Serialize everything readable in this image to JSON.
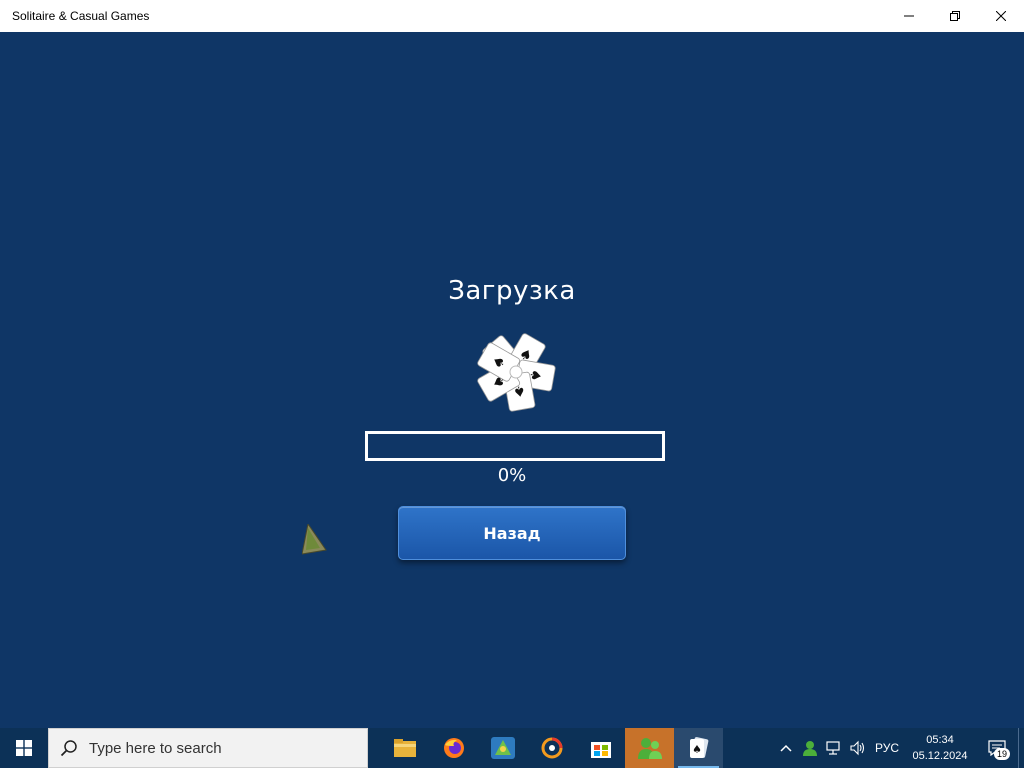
{
  "window": {
    "title": "Solitaire & Casual Games",
    "controls": [
      "minimize-icon",
      "restore-icon",
      "close-icon"
    ]
  },
  "loading": {
    "title": "Загрузка",
    "progress_percent": 0,
    "progress_text": "0%",
    "back_label": "Назад"
  },
  "taskbar": {
    "search_placeholder": "Type here to search",
    "apps": [
      {
        "name": "file-explorer-icon"
      },
      {
        "name": "firefox-icon"
      },
      {
        "name": "game-app-icon"
      },
      {
        "name": "media-player-icon"
      },
      {
        "name": "microsoft-store-icon"
      },
      {
        "name": "users-app-icon",
        "state": "active"
      },
      {
        "name": "solitaire-app-icon",
        "state": "open"
      }
    ],
    "language": "РУС",
    "time": "05:34",
    "date": "05.12.2024",
    "notification_count": "19"
  },
  "colors": {
    "background": "#0f3666",
    "button": "#1f5fb4",
    "taskbar": "#0c3157",
    "active_app": "#c7722a"
  }
}
